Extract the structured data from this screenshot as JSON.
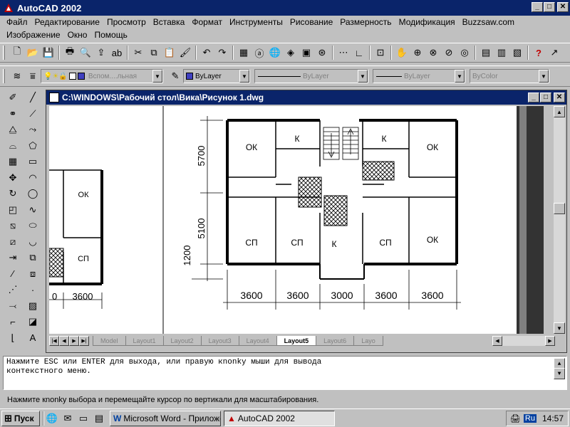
{
  "app": {
    "title": "AutoCAD 2002"
  },
  "menu": {
    "row1": [
      "Файл",
      "Редактирование",
      "Просмотр",
      "Вставка",
      "Формат",
      "Инструменты",
      "Рисование",
      "Размерность",
      "Модификация",
      "Buzzsaw.com"
    ],
    "row2": [
      "Изображение",
      "Окно",
      "Помощь"
    ]
  },
  "props": {
    "layer": "Вспом....льная",
    "color": "ByLayer",
    "linetype": "ByLayer",
    "lineweight": "ByLayer",
    "plotstyle": "ByColor"
  },
  "doc": {
    "title": "C:\\WINDOWS\\Рабочий стол\\Вика\\Рисунок 1.dwg"
  },
  "plan": {
    "rooms": [
      "ОК",
      "К",
      "К",
      "ОК",
      "СП",
      "СП",
      "К",
      "СП",
      "ОК"
    ],
    "side_rooms": [
      "ОК",
      "СП"
    ],
    "dims_bottom": [
      "3600",
      "3600",
      "3000",
      "3600",
      "3600"
    ],
    "dims_side_bottom": [
      "0",
      "3600"
    ],
    "dims_left": [
      "5700",
      "5100",
      "1200"
    ]
  },
  "tabs": [
    "Model",
    "Layout1",
    "Layout2",
    "Layout3",
    "Layout4",
    "Layout5",
    "Layout6",
    "Layo"
  ],
  "active_tab": "Layout5",
  "command": {
    "line1": "Нажмите ESC или ENTER для выхода, или правую кnonkу мыши для вывода",
    "line2": "контекстного меню."
  },
  "status": "Нажмите кnonkу выбора и перемещайте курсор по вертикали для масштабирования.",
  "taskbar": {
    "start": "Пуск",
    "task1": "Microsoft Word - Приложе...",
    "task2": "AutoCAD 2002",
    "lang": "Ru",
    "clock": "14:57"
  }
}
